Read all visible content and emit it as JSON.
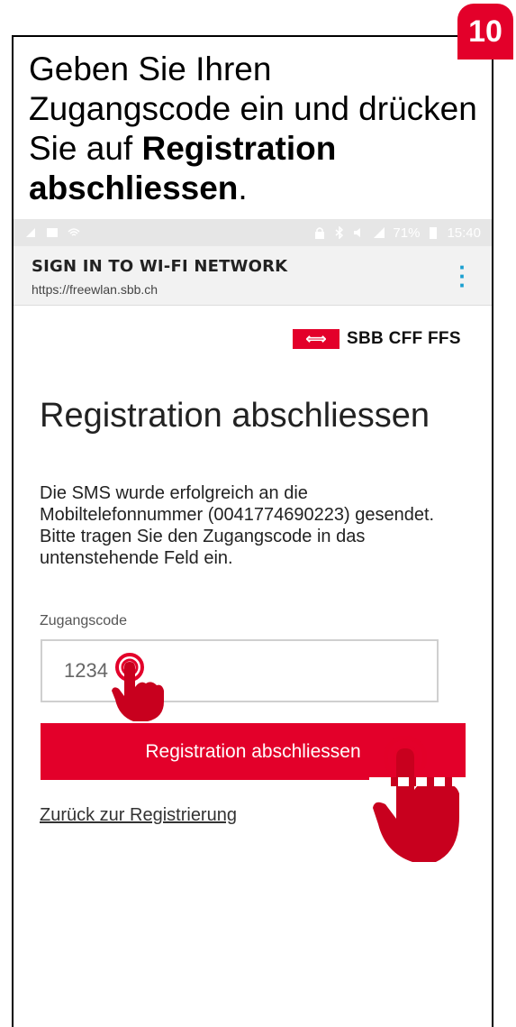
{
  "step": {
    "number": "10"
  },
  "instruction": {
    "part1": "Geben Sie Ihren Zugangscode ein und drücken Sie auf ",
    "bold": "Registration abschliessen",
    "part2": "."
  },
  "statusbar": {
    "battery": "71%",
    "time": "15:40",
    "icons": [
      "data-icon",
      "image-icon",
      "wifi-icon",
      "lock-icon",
      "bluetooth-icon",
      "mute-icon",
      "signal-icon",
      "battery-icon"
    ]
  },
  "appbar": {
    "title": "SIGN IN TO WI-FI NETWORK",
    "url": "https://freewlan.sbb.ch",
    "menu_icon": "more-vert-icon"
  },
  "logo": {
    "text": "SBB CFF FFS",
    "color": "#e3002a"
  },
  "page": {
    "title": "Registration abschliessen",
    "description": "Die SMS wurde erfolgreich an die Mobiltelefonnummer (0041774690223) gesendet. Bitte tragen Sie den Zugangscode in das untenstehende Feld ein.",
    "field_label": "Zugangscode",
    "field_value": "1234",
    "submit_label": "Registration abschliessen",
    "back_link": "Zurück zur Registrierung"
  },
  "colors": {
    "accent": "#e3002a"
  }
}
